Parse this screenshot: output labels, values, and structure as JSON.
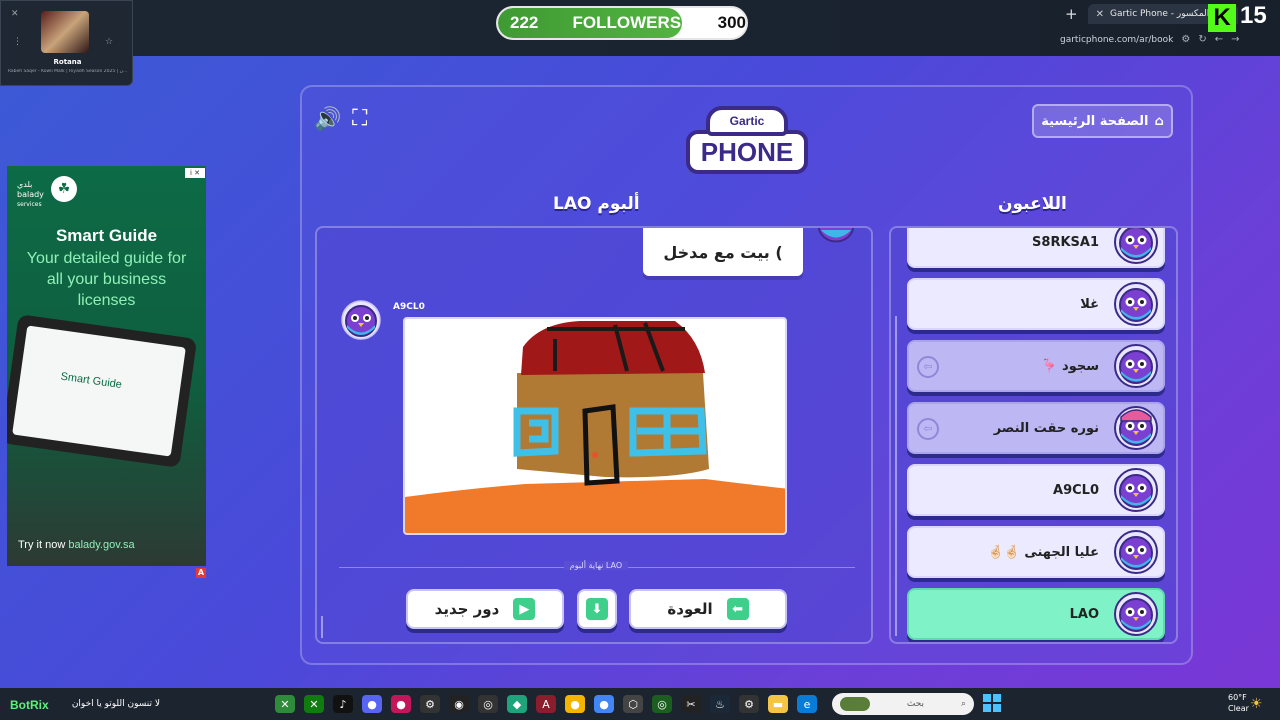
{
  "browser": {
    "tab_title": "Gartic Phone - المكسور",
    "url": "garticphone.com/ar/book",
    "new_tab_symbol": "+",
    "tab_close_symbol": "✕"
  },
  "stream_overlay": {
    "kick_letter": "K",
    "kick_count": "15",
    "followers_current": "222",
    "followers_label": "FOLLOWERS",
    "followers_goal": "300",
    "followers_progress": 0.74
  },
  "media": {
    "title": "Rotana",
    "subtitle": "Rabeh Saqer - Kowli Malk | Riyadh Season 2025 | ن...",
    "close_symbol": "✕",
    "star_symbol": "☆"
  },
  "ad": {
    "logo_ar": "بلدي",
    "logo_en": "balady",
    "logo_en2": "services",
    "title": "Smart Guide",
    "subtitle": "Your detailed guide for all your business licenses",
    "screen_text": "Smart Guide",
    "cta_prefix": "Try it now",
    "cta_link": "balady.gov.sa",
    "adchoices": "i ✕",
    "badge": "A"
  },
  "game": {
    "home_label": "الصفحة الرئيسية",
    "logo_top": "Gartic",
    "logo_main": "PHONE",
    "players_title": "اللاعبون",
    "album_title": "ألبوم LAO",
    "prompt_text": ") بيت مع مدخل",
    "artist_name": "A9CL0",
    "end_label": "نهاية ألبوم LAO",
    "new_round_label": "دور جديد",
    "back_label": "العودة",
    "players": [
      {
        "name": "S8RKSA1",
        "state": "normal",
        "hat": false
      },
      {
        "name": "غلا",
        "state": "normal",
        "hat": false
      },
      {
        "name": "سجود 🦩",
        "state": "dim",
        "hat": false
      },
      {
        "name": "نوره حقت النصر",
        "state": "dim",
        "hat": true
      },
      {
        "name": "A9CL0",
        "state": "normal",
        "hat": false
      },
      {
        "name": "عليا الجهنى 🤞🏻🤞🏻",
        "state": "normal",
        "hat": false
      },
      {
        "name": "LAO",
        "state": "active",
        "hat": false
      }
    ]
  },
  "taskbar": {
    "botrix": "BotRix",
    "ticker": "لا تنسون اللوتو يا اخوان",
    "search_placeholder": "بحث",
    "weather_temp": "60°F",
    "weather_desc": "Clear"
  },
  "icons": {
    "sound": "🔊",
    "fullscreen": "⛶",
    "home": "⌂",
    "play": "▶",
    "download": "⬇",
    "back": "⬅",
    "leave": "⇦",
    "search": "⌕",
    "sun": "☀"
  }
}
